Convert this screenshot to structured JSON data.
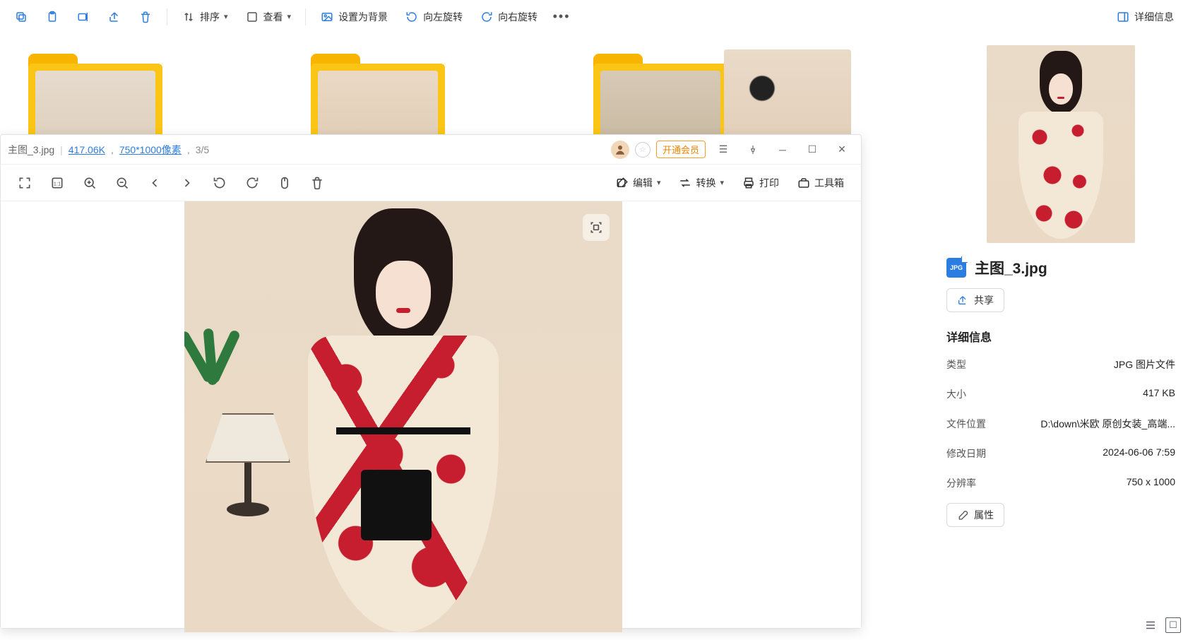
{
  "top_toolbar": {
    "sort": "排序",
    "view": "查看",
    "set_as_bg": "设置为背景",
    "rotate_left": "向左旋转",
    "rotate_right": "向右旋转",
    "details": "详细信息"
  },
  "viewer": {
    "title": {
      "filename": "主图_3.jpg",
      "filesize": "417.06K",
      "resolution": "750*1000像素",
      "index": "3/5"
    },
    "vip_btn": "开通会员",
    "toolbar": {
      "edit": "编辑",
      "convert": "转换",
      "print": "打印",
      "toolbox": "工具箱"
    }
  },
  "details": {
    "filename": "主图_3.jpg",
    "share": "共享",
    "section_title": "详细信息",
    "rows": {
      "type": {
        "k": "类型",
        "v": "JPG 图片文件"
      },
      "size": {
        "k": "大小",
        "v": "417 KB"
      },
      "location": {
        "k": "文件位置",
        "v": "D:\\down\\米欧 原创女装_高端..."
      },
      "modified": {
        "k": "修改日期",
        "v": "2024-06-06 7:59"
      },
      "resolution": {
        "k": "分辨率",
        "v": "750 x 1000"
      }
    },
    "attributes_btn": "属性"
  }
}
